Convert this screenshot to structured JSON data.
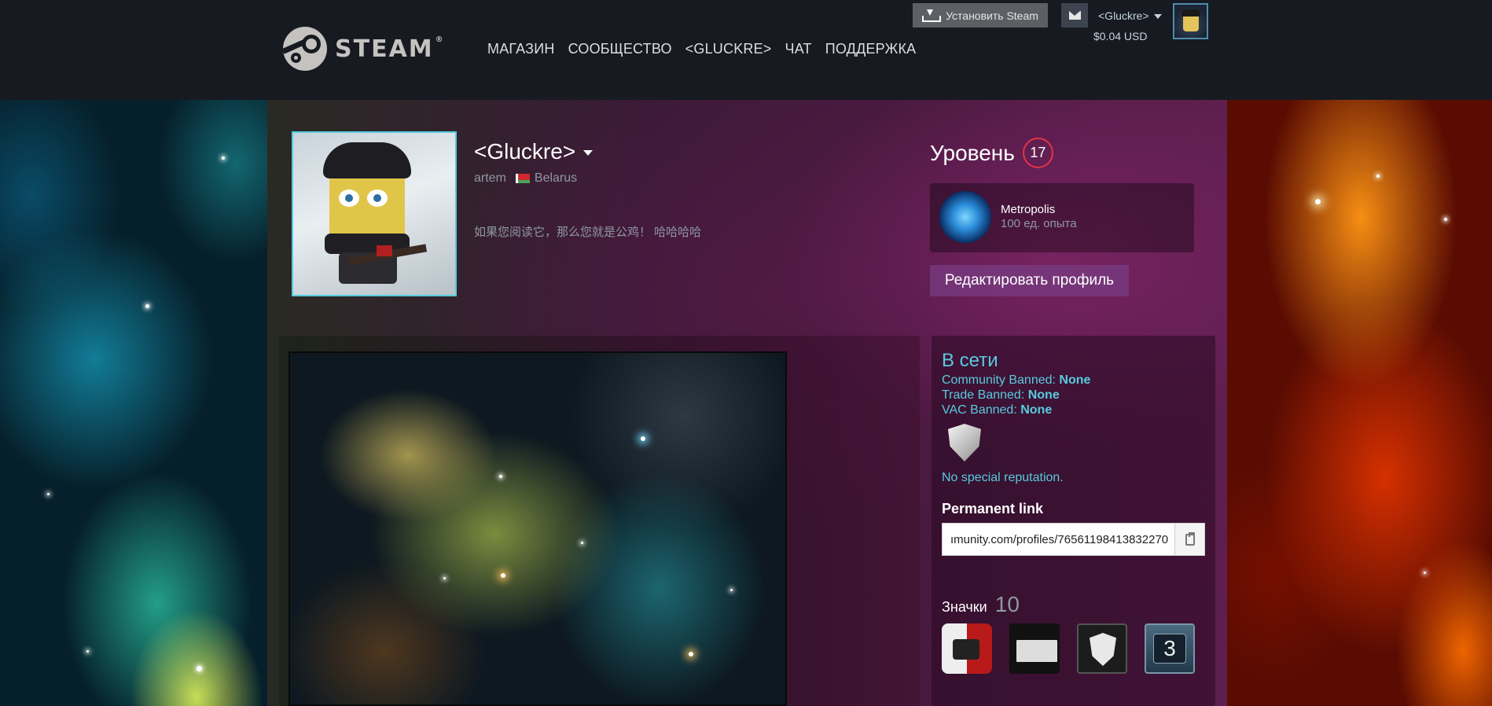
{
  "header": {
    "logo_text": "STEAM",
    "nav": [
      "МАГАЗИН",
      "СООБЩЕСТВО",
      "<GLUCKRE>",
      "ЧАТ",
      "ПОДДЕРЖКА"
    ],
    "install_label": "Установить Steam",
    "account_name": "<Gluckre>",
    "wallet": "$0.04 USD"
  },
  "profile": {
    "persona_name": "<Gluckre>",
    "real_name": "artem",
    "country": "Belarus",
    "summary": "如果您阅读它，那么您就是公鸡！ 哈哈哈哈",
    "level_label": "Уровень",
    "level": "17",
    "favorite_badge": {
      "name": "Metropolis",
      "xp": "100 ед. опыта"
    },
    "edit_label": "Редактировать профиль"
  },
  "sidebar": {
    "status": "В сети",
    "bans": [
      {
        "label": "Community Banned:",
        "value": "None"
      },
      {
        "label": "Trade Banned:",
        "value": "None"
      },
      {
        "label": "VAC Banned:",
        "value": "None"
      }
    ],
    "reputation": "No special reputation.",
    "permanent_link_title": "Permanent link",
    "permanent_link_value": "ımunity.com/profiles/76561198413832270",
    "badges_label": "Значки",
    "badges_count": "10",
    "badge_tile_number": "3"
  },
  "colors": {
    "accent": "#57cbde",
    "level_ring": "#e4324b",
    "header_bg": "#171a21"
  }
}
